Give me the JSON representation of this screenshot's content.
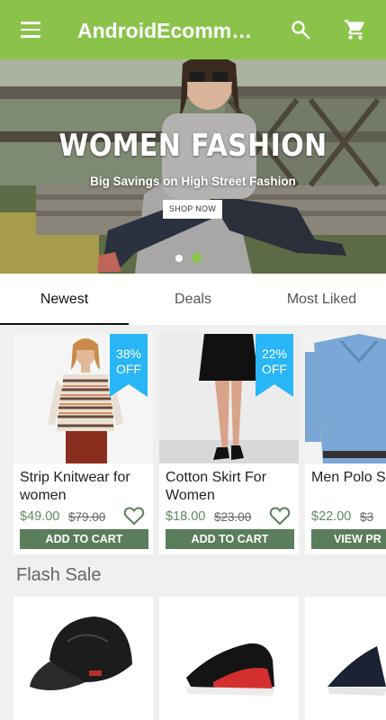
{
  "appbar": {
    "title": "AndroidEcommer...",
    "menu_icon": "hamburger-menu-icon",
    "search_icon": "search-icon",
    "cart_icon": "shopping-cart-icon",
    "color": "#8bc34a"
  },
  "banner": {
    "title": "WOMEN FASHION",
    "subtitle": "Big Savings on High Street Fashion",
    "button": "SHOP NOW",
    "slide_count": 2,
    "active_slide": 2
  },
  "tabs": [
    {
      "label": "Newest",
      "active": true
    },
    {
      "label": "Deals",
      "active": false
    },
    {
      "label": "Most Liked",
      "active": false
    }
  ],
  "products": [
    {
      "name": "Strip Knitwear for women",
      "price": "$49.00",
      "old_price": "$79.00",
      "discount_line1": "38%",
      "discount_line2": "OFF",
      "button": "ADD TO CART"
    },
    {
      "name": "Cotton Skirt For Women",
      "price": "$18.00",
      "old_price": "$23.00",
      "discount_line1": "22%",
      "discount_line2": "OFF",
      "button": "ADD TO CART"
    },
    {
      "name": "Men Polo Shirt",
      "price": "$22.00",
      "old_price": "$3",
      "button": "VIEW PR"
    }
  ],
  "flash_sale": {
    "title": "Flash Sale"
  },
  "colors": {
    "accent": "#8bc34a",
    "ribbon": "#29b6f6",
    "button": "#5a7d5b",
    "price": "#5b8a5f"
  }
}
